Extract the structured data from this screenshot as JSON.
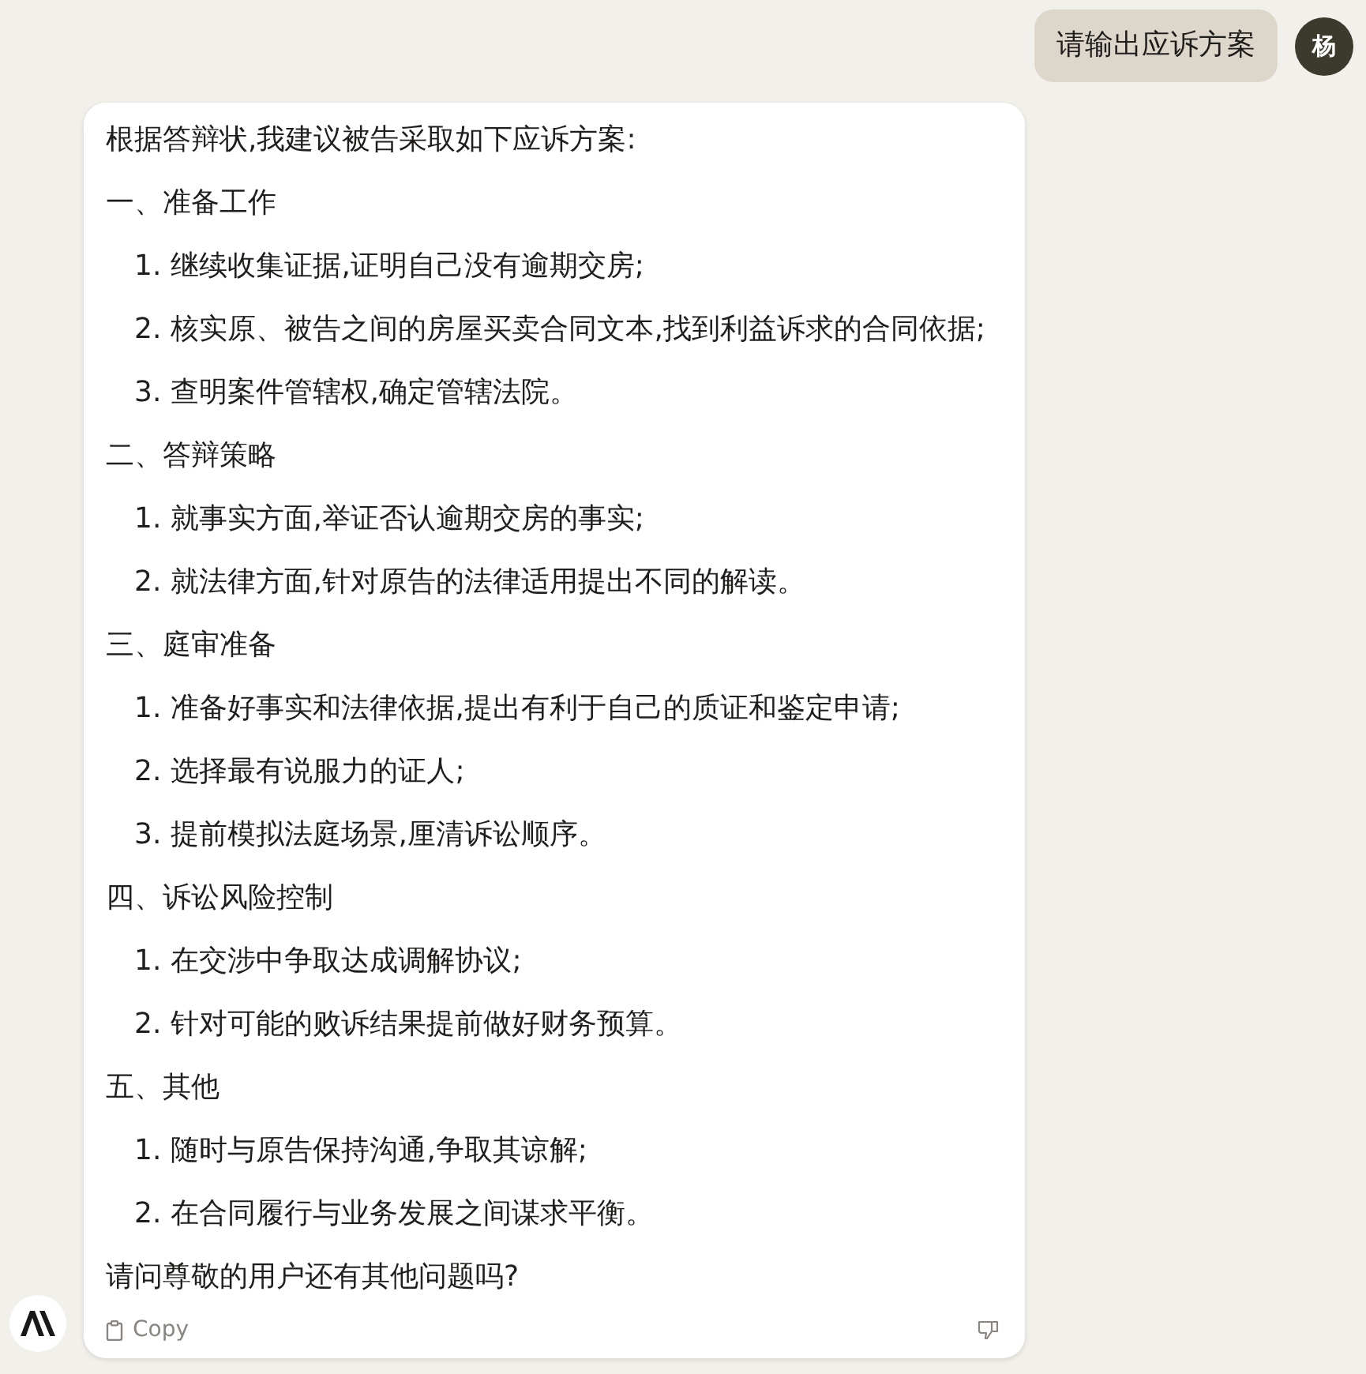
{
  "user_message": {
    "text": "请输出应诉方案",
    "avatar": "杨"
  },
  "reply": {
    "intro": "根据答辩状,我建议被告采取如下应诉方案:",
    "sections": [
      {
        "heading": "一、准备工作",
        "items": [
          {
            "number": "1.",
            "text": "继续收集证据,证明自己没有逾期交房;"
          },
          {
            "number": "2.",
            "text": "核实原、被告之间的房屋买卖合同文本,找到利益诉求的合同依据;"
          },
          {
            "number": "3.",
            "text": "查明案件管辖权,确定管辖法院。"
          }
        ]
      },
      {
        "heading": "二、答辩策略",
        "items": [
          {
            "number": "1.",
            "text": "就事实方面,举证否认逾期交房的事实;"
          },
          {
            "number": "2.",
            "text": "就法律方面,针对原告的法律适用提出不同的解读。"
          }
        ]
      },
      {
        "heading": "三、庭审准备",
        "items": [
          {
            "number": "1.",
            "text": "准备好事实和法律依据,提出有利于自己的质证和鉴定申请;"
          },
          {
            "number": "2.",
            "text": "选择最有说服力的证人;"
          },
          {
            "number": "3.",
            "text": "提前模拟法庭场景,厘清诉讼顺序。"
          }
        ]
      },
      {
        "heading": "四、诉讼风险控制",
        "items": [
          {
            "number": "1.",
            "text": "在交涉中争取达成调解协议;"
          },
          {
            "number": "2.",
            "text": "针对可能的败诉结果提前做好财务预算。"
          }
        ]
      },
      {
        "heading": "五、其他",
        "items": [
          {
            "number": "1.",
            "text": "随时与原告保持沟通,争取其谅解;"
          },
          {
            "number": "2.",
            "text": "在合同履行与业务发展之间谋求平衡。"
          }
        ]
      }
    ],
    "closing": "请问尊敬的用户还有其他问题吗?",
    "copy_label": "Copy"
  }
}
